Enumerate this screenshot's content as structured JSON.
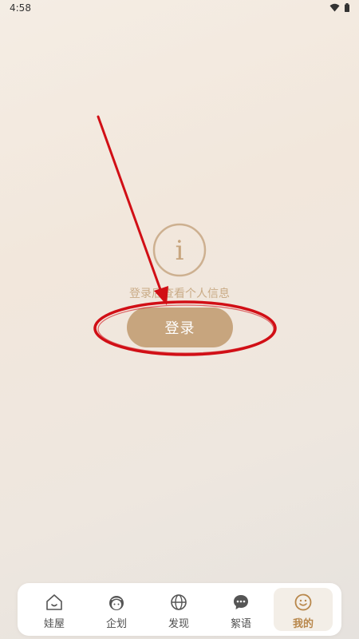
{
  "status_bar": {
    "time": "4:58",
    "wifi_icon": "wifi-icon",
    "battery_icon": "battery-icon"
  },
  "main": {
    "info_icon": "info-circle-icon",
    "info_glyph": "i",
    "hint_text": "登录后查看个人信息",
    "login_button_label": "登录"
  },
  "tab_bar": {
    "items": [
      {
        "label": "娃屋",
        "icon": "house-icon",
        "active": false
      },
      {
        "label": "企划",
        "icon": "doll-face-icon",
        "active": false
      },
      {
        "label": "发现",
        "icon": "globe-icon",
        "active": false
      },
      {
        "label": "絮语",
        "icon": "chat-bubble-icon",
        "active": false
      },
      {
        "label": "我的",
        "icon": "smiley-icon",
        "active": true
      }
    ]
  },
  "colors": {
    "accent": "#c7a57e",
    "active_tab_text": "#b8874b",
    "hint_text": "#c9ab86",
    "annotation_red": "#d10f16"
  }
}
